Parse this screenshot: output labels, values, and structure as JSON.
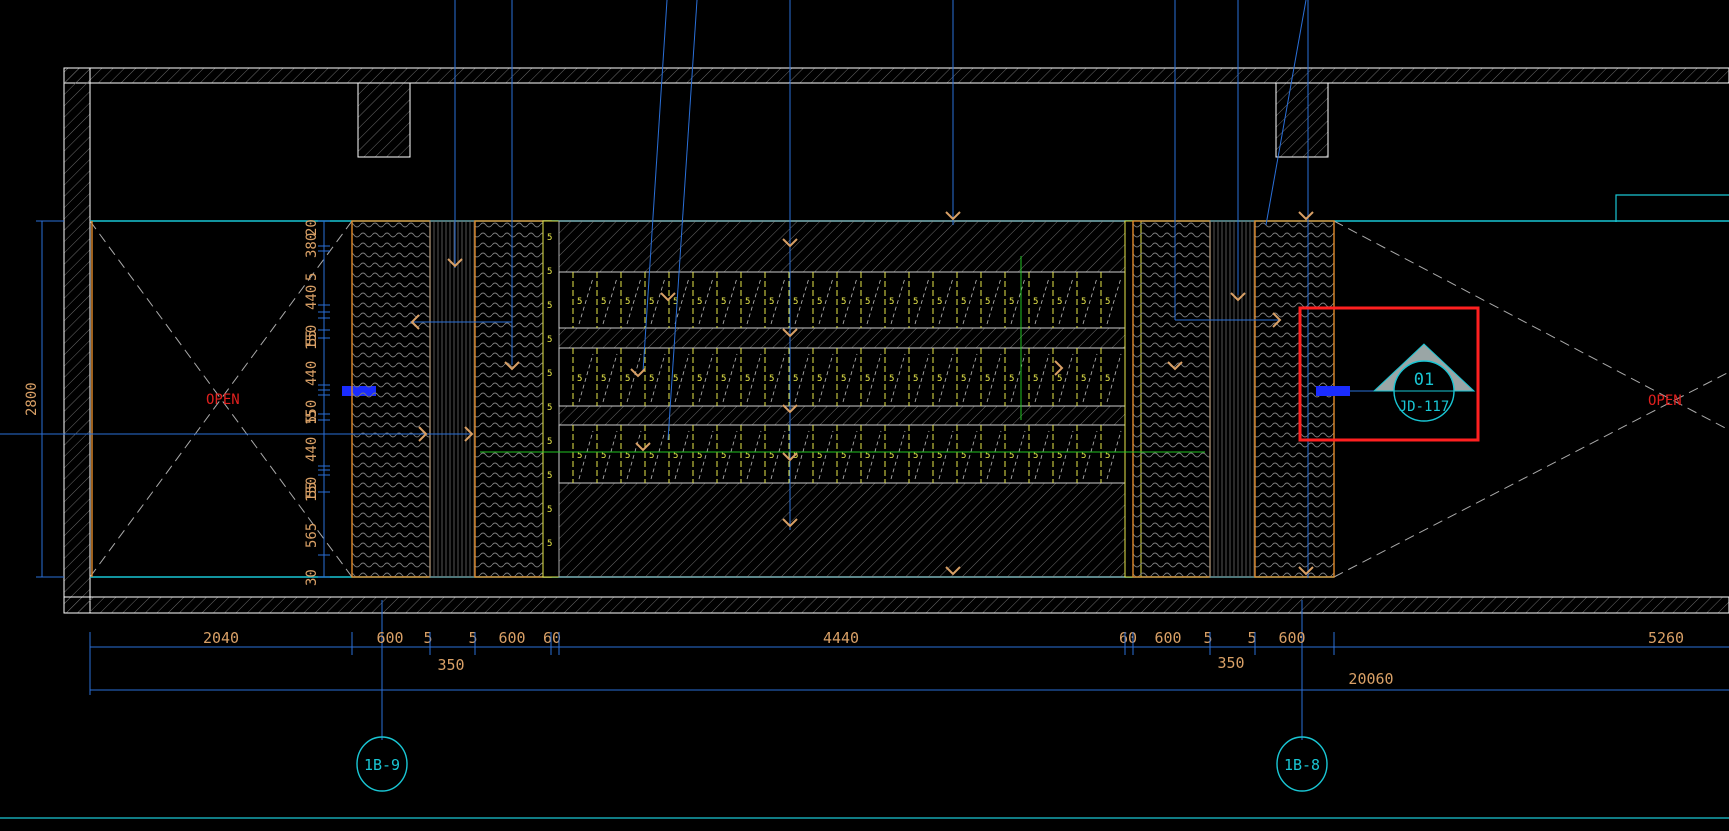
{
  "drawing": {
    "colors": {
      "background": "#000000",
      "wall": "#ffffff",
      "floor_line": "#19c6d4",
      "dimension": "#d9a066",
      "leader": "#2a6fd8",
      "panel_edge": "#e08a2a",
      "detail_text": "#e8e84a",
      "open_text": "#e0201e",
      "highlight_box": "#ff2020",
      "grid_bubble": "#19c6d4",
      "center_line": "#22c522",
      "marker_blue": "#1a2cff"
    },
    "openings": {
      "left_label": "OPEN",
      "right_label": "OPEN"
    },
    "section_marker": {
      "number": "01",
      "sheet": "JD-117"
    },
    "grid_bubbles": {
      "left": "1B-9",
      "right": "1B-8"
    },
    "overall_height": "2800",
    "vertical_dims": [
      "380",
      "20",
      "5",
      "440",
      "5",
      "5",
      "150",
      "440",
      "5",
      "5",
      "150",
      "440",
      "5",
      "5",
      "150",
      "565",
      "30"
    ],
    "horizontal_dims": {
      "row1": [
        "2040",
        "600",
        "5",
        "5",
        "600",
        "60",
        "4440",
        "60",
        "600",
        "5",
        "5",
        "600",
        "5260"
      ],
      "row2": [
        "350",
        "350",
        "20060"
      ]
    },
    "shelf_text": "5"
  }
}
